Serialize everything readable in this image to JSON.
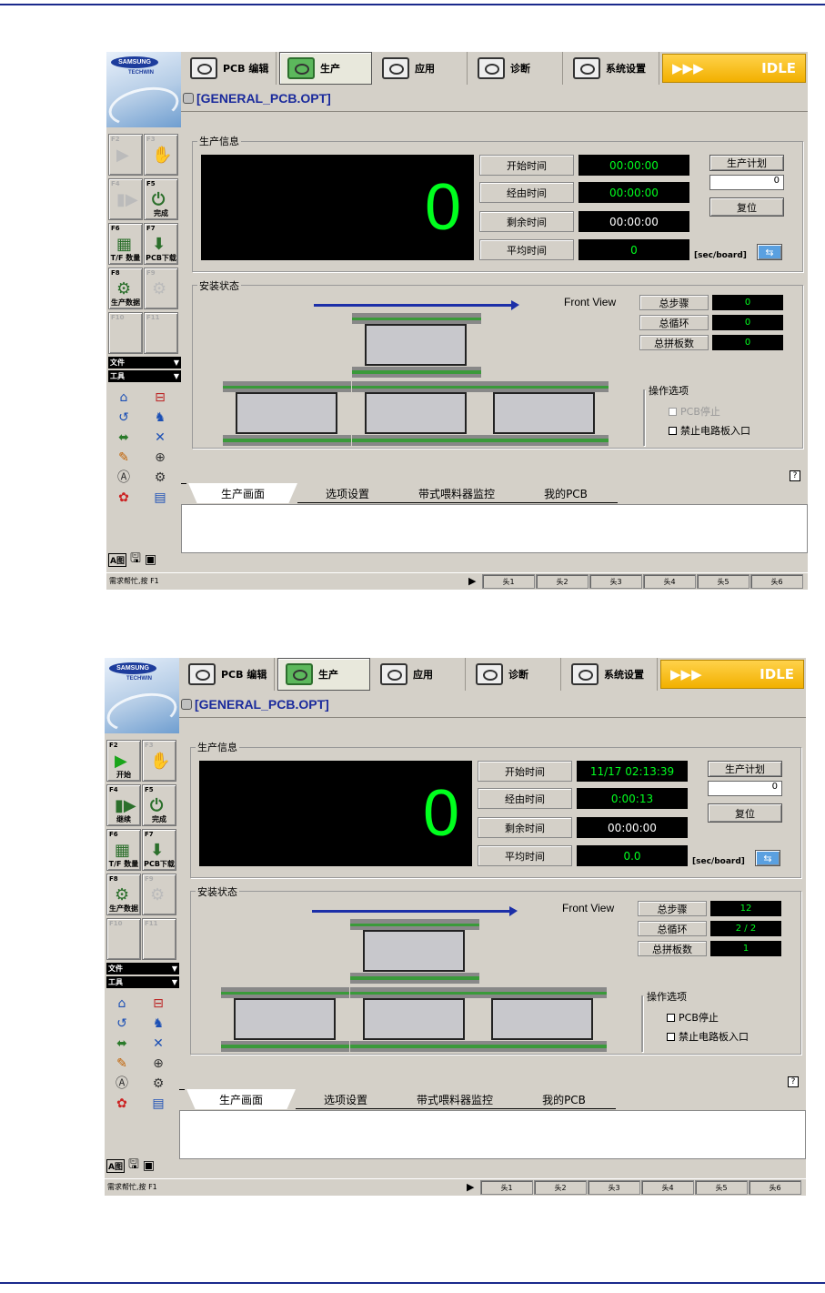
{
  "menu_tabs": [
    {
      "label": "PCB 编辑"
    },
    {
      "label": "生产"
    },
    {
      "label": "应用"
    },
    {
      "label": "诊断"
    },
    {
      "label": "系统设置"
    }
  ],
  "status_badge": {
    "arrows": "▶▶▶",
    "label": "IDLE"
  },
  "logo": {
    "brand": "SAMSUNG",
    "sub": "TECHWIN"
  },
  "filename": "[GENERAL_PCB.OPT]",
  "side_menu": {
    "file": "文件",
    "tools": "工具"
  },
  "sections": {
    "production_info": "生产信息",
    "mount_status": "安装状态",
    "front_view": "Front View",
    "options": "操作选项"
  },
  "labels": {
    "start_time": "开始时间",
    "elapsed_time": "经由时间",
    "remaining_time": "剩余时间",
    "avg_time": "平均时间",
    "plan": "生产计划",
    "reset": "复位",
    "unit": "[sec/board]",
    "total_steps": "总步骤",
    "total_cycles": "总循环",
    "total_boards": "总拼板数",
    "pcb_stop": "PCB停止",
    "block_entry": "禁止电路板入口",
    "help": "?"
  },
  "tabs": [
    {
      "label": "生产画面"
    },
    {
      "label": "选项设置"
    },
    {
      "label": "带式喂料器监控"
    },
    {
      "label": "我的PCB"
    }
  ],
  "statusbar": {
    "help_text": "需求帮忙,按 F1",
    "heads": [
      "头1",
      "头2",
      "头3",
      "头4",
      "头5",
      "头6"
    ]
  },
  "bottom_icons": {
    "a": "A图"
  },
  "screens": [
    {
      "count": "0",
      "fkeys": [
        {
          "key": "F2",
          "label": "",
          "glyph": "▶",
          "enabled": false
        },
        {
          "key": "F3",
          "label": "",
          "glyph": "✋",
          "enabled": false
        },
        {
          "key": "F4",
          "label": "",
          "glyph": "▮▶",
          "enabled": false
        },
        {
          "key": "F5",
          "label": "完成",
          "glyph": "⏻",
          "enabled": true
        },
        {
          "key": "F6",
          "label": "T/F 数量",
          "glyph": "▦",
          "enabled": true
        },
        {
          "key": "F7",
          "label": "PCB下载",
          "glyph": "⬇",
          "enabled": true
        },
        {
          "key": "F8",
          "label": "生产数据",
          "glyph": "⚙",
          "enabled": true
        },
        {
          "key": "F9",
          "label": "",
          "glyph": "⚙",
          "enabled": false
        },
        {
          "key": "F10",
          "label": "",
          "glyph": "",
          "enabled": false
        },
        {
          "key": "F11",
          "label": "",
          "glyph": "",
          "enabled": false
        }
      ],
      "start": "00:00:00",
      "elapsed": "00:00:00",
      "remaining": "00:00:00",
      "avg": "0",
      "plan_value": "0",
      "steps": "0",
      "cycles": "0",
      "boards": "0",
      "pcb_stop_enabled": false
    },
    {
      "count": "0",
      "fkeys": [
        {
          "key": "F2",
          "label": "开始",
          "glyph": "▶",
          "enabled": true
        },
        {
          "key": "F3",
          "label": "",
          "glyph": "✋",
          "enabled": false
        },
        {
          "key": "F4",
          "label": "继续",
          "glyph": "▮▶",
          "enabled": true
        },
        {
          "key": "F5",
          "label": "完成",
          "glyph": "⏻",
          "enabled": true
        },
        {
          "key": "F6",
          "label": "T/F 数量",
          "glyph": "▦",
          "enabled": true
        },
        {
          "key": "F7",
          "label": "PCB下载",
          "glyph": "⬇",
          "enabled": true
        },
        {
          "key": "F8",
          "label": "生产数据",
          "glyph": "⚙",
          "enabled": true
        },
        {
          "key": "F9",
          "label": "",
          "glyph": "⚙",
          "enabled": false
        },
        {
          "key": "F10",
          "label": "",
          "glyph": "",
          "enabled": false
        },
        {
          "key": "F11",
          "label": "",
          "glyph": "",
          "enabled": false
        }
      ],
      "start": "11/17 02:13:39",
      "elapsed": "0:00:13",
      "remaining": "00:00:00",
      "avg": "0.0",
      "plan_value": "0",
      "steps": "12",
      "cycles": "2 / 2",
      "boards": "1",
      "pcb_stop_enabled": true
    }
  ],
  "colors": {
    "idle": "#f2b000",
    "lcd_green": "#00ff1e",
    "title_blue": "#1a2a9c",
    "arrow_blue": "#1c2fa8"
  }
}
